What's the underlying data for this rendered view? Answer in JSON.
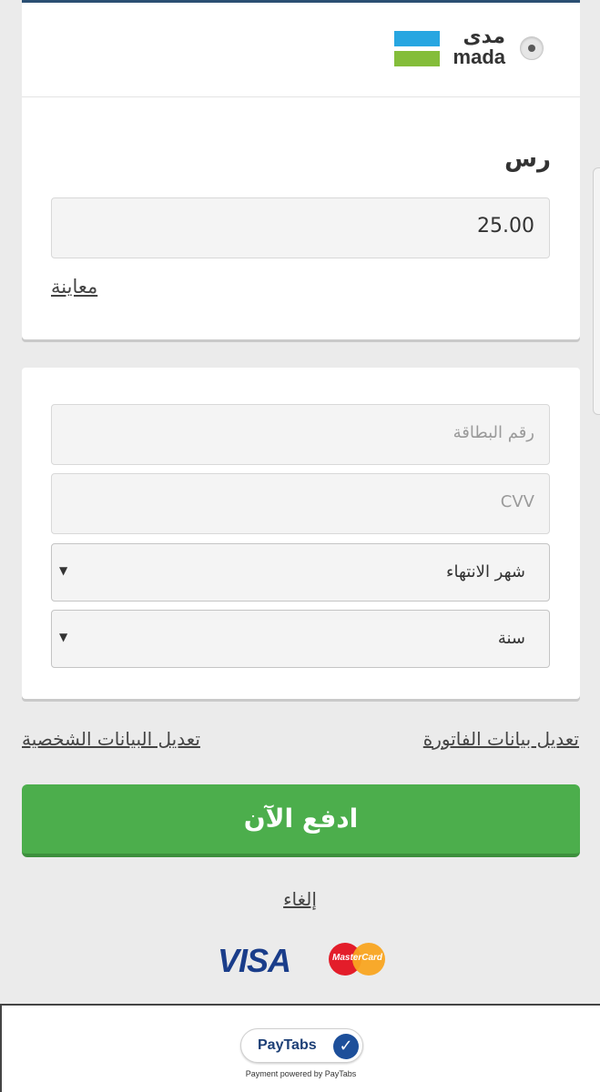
{
  "payment_method": {
    "logo_text_ar": "مدى",
    "logo_text_en": "mada",
    "selected": true,
    "colors": {
      "blue": "#27a6e1",
      "green": "#84bd3a"
    }
  },
  "amount": {
    "currency_label": "رس",
    "value": "25.00",
    "preview_link": "معاينة"
  },
  "card_form": {
    "card_number_placeholder": "رقم البطاقة",
    "cvv_placeholder": "CVV",
    "expiry_month_label": "شهر الانتهاء",
    "expiry_year_label": "سنة"
  },
  "links": {
    "edit_billing": "تعديل بيانات الفاتورة",
    "edit_personal": "تعديل البيانات الشخصية",
    "cancel": "إلغاء"
  },
  "pay_button": {
    "label": "ادفع الآن",
    "color": "#4cae4c"
  },
  "card_brands": {
    "visa": "VISA",
    "mastercard": "MasterCard"
  },
  "footer": {
    "brand": "PayTabs",
    "powered_by": "Payment powered by PayTabs"
  }
}
